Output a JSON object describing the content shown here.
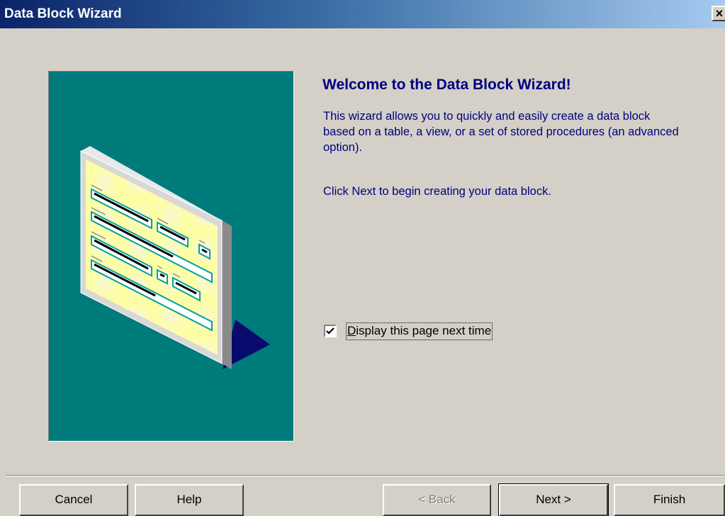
{
  "window": {
    "title": "Data Block Wizard",
    "close_label": "×"
  },
  "welcome": {
    "heading": "Welcome to the Data Block Wizard!",
    "paragraph1": "This wizard allows you to quickly and easily create a data block based on a table, a view, or a set of stored procedures (an advanced option).",
    "paragraph2": "Click Next to begin creating your data block."
  },
  "options": {
    "display_next_time": {
      "label_prefix": "D",
      "label_rest": "isplay this page next time",
      "checked": true
    }
  },
  "buttons": {
    "cancel": "Cancel",
    "help": "Help",
    "back": "< Back",
    "next": "Next >",
    "finish": "Finish"
  },
  "colors": {
    "illustration_bg": "#007b7b",
    "accent_text": "#000080",
    "dialog_bg": "#d4d0c8"
  }
}
